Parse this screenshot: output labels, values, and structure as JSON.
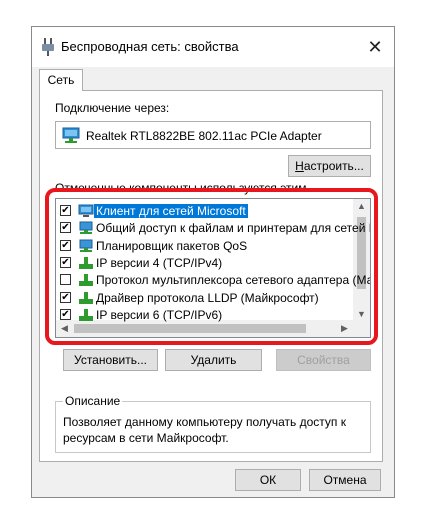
{
  "window": {
    "title": "Беспроводная сеть: свойства",
    "close_symbol": "✕"
  },
  "tab": {
    "label": "Сеть"
  },
  "connect_using": {
    "label": "Подключение через:",
    "adapter": "Realtek RTL8822BE 802.11ac PCIe Adapter",
    "configure_button": "Настроить..."
  },
  "components": {
    "label": "Отмеченные компоненты используются этим подключением:",
    "items": [
      {
        "label": "Клиент для сетей Microsoft",
        "checked": true,
        "selected": true,
        "icon": "network-client-icon"
      },
      {
        "label": "Общий доступ к файлам и принтерам для сетей Mi",
        "checked": true,
        "selected": false,
        "icon": "network-service-icon"
      },
      {
        "label": "Планировщик пакетов QoS",
        "checked": true,
        "selected": false,
        "icon": "network-service-icon"
      },
      {
        "label": "IP версии 4 (TCP/IPv4)",
        "checked": true,
        "selected": false,
        "icon": "protocol-icon"
      },
      {
        "label": "Протокол мультиплексора сетевого адаптера (Май",
        "checked": false,
        "selected": false,
        "icon": "protocol-icon"
      },
      {
        "label": "Драйвер протокола LLDP (Майкрософт)",
        "checked": true,
        "selected": false,
        "icon": "protocol-icon"
      },
      {
        "label": "IP версии 6 (TCP/IPv6)",
        "checked": true,
        "selected": false,
        "icon": "protocol-icon"
      }
    ]
  },
  "buttons": {
    "install": "Установить...",
    "uninstall": "Удалить",
    "properties": "Свойства",
    "ok": "ОК",
    "cancel": "Отмена"
  },
  "description": {
    "title": "Описание",
    "text": "Позволяет данному компьютеру получать доступ к ресурсам в сети Майкрософт."
  },
  "colors": {
    "selection": "#0078d7",
    "highlight_frame": "#e8171d",
    "protocol_icon": "#2e9b2e"
  }
}
